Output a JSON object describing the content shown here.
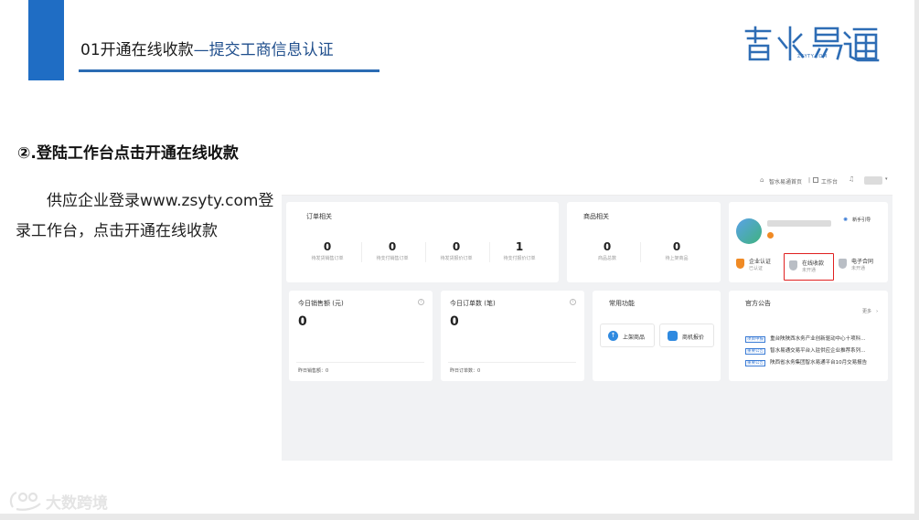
{
  "slide": {
    "title": "01开通在线收款",
    "title_emphasis": "—提交工商信息认证",
    "step_title": "②.登陆工作台点击开通在线收款",
    "description": "供应企业登录www.zsyty.com登录工作台，点击开通在线收款",
    "logo_sub": "ZSYTY.COM",
    "watermark": "大数跨境",
    "accent_color": "#1f6dc4"
  },
  "topbar": {
    "home_link": "智水易通首页",
    "workbench_link": "工作台"
  },
  "orders": {
    "title": "订单相关",
    "stats": [
      {
        "value": "0",
        "label": "待发货销售订单"
      },
      {
        "value": "0",
        "label": "待支付销售订单"
      },
      {
        "value": "0",
        "label": "待发货报价订单"
      },
      {
        "value": "1",
        "label": "待支付报价订单"
      }
    ]
  },
  "products": {
    "title": "商品相关",
    "stats": [
      {
        "value": "0",
        "label": "商品总数"
      },
      {
        "value": "0",
        "label": "待上架商品"
      }
    ]
  },
  "profile": {
    "guide_label": "新手引导",
    "badges": [
      {
        "name": "企业认证",
        "status": "已认证"
      },
      {
        "name": "在线收款",
        "status": "未开通"
      },
      {
        "name": "电子合同",
        "status": "未开通"
      }
    ],
    "highlight_color": "#e02020"
  },
  "sales_today": {
    "title": "今日销售额 (元)",
    "value": "0",
    "yesterday": "昨日销售额：0"
  },
  "orders_today": {
    "title": "今日订单数 (笔)",
    "value": "0",
    "yesterday": "昨日订单数：0"
  },
  "functions": {
    "title": "常用功能",
    "items": [
      "上架商品",
      "商机报价"
    ]
  },
  "notices": {
    "title": "官方公告",
    "more": "更多",
    "items": [
      {
        "tag": "项目申报",
        "text": "重台陕陕西水务产业创新驱动中心十项科…"
      },
      {
        "tag": "重要公告",
        "text": "智水易通交易平台入驻供应企业推荐系列…"
      },
      {
        "tag": "重要公告",
        "text": "陕西省水务集团智水易通平台10月交易报告"
      }
    ]
  }
}
